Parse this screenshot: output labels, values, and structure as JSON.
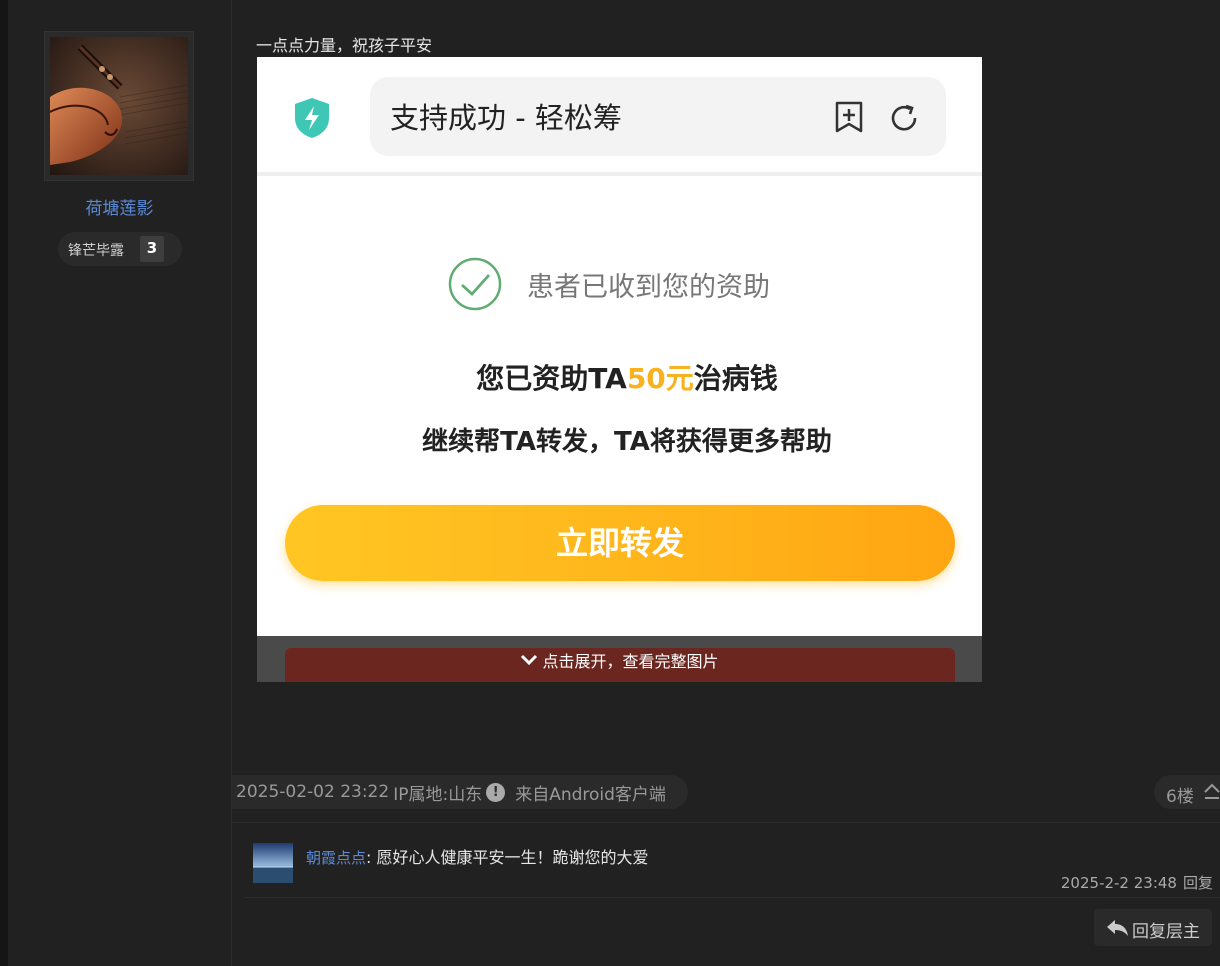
{
  "post": {
    "author": {
      "name": "荷塘莲影",
      "level_name": "锋芒毕露",
      "level_number": "3"
    },
    "content_text": "一点点力量，祝孩子平安",
    "image": {
      "title": "支持成功 - 轻松筹",
      "received_text": "患者已收到您的资助",
      "line1_prefix": "您已资助TA",
      "line1_amount": "50元",
      "line1_suffix": "治病钱",
      "line2": "继续帮TA转发，TA将获得更多帮助",
      "button_label": "立即转发",
      "accent_color": "#f8b21d"
    },
    "expand_label": "点击展开，查看完整图片",
    "meta": {
      "datetime": "2025-02-02 23:22",
      "ip_location": "IP属地:山东",
      "source": "来自Android客户端"
    },
    "floor": "6楼"
  },
  "reply": {
    "username": "朝霞点点",
    "separator": ":",
    "text": "愿好心人健康平安一生！跪谢您的大爱",
    "time": "2025-2-2 23:48",
    "reply_link": "回复"
  },
  "reply_main_button": "回复层主",
  "colors": {
    "link_blue": "#5b8ad6",
    "background": "#212121"
  }
}
